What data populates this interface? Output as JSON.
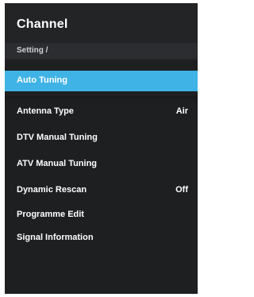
{
  "header": {
    "title": "Channel",
    "breadcrumb": "Setting /"
  },
  "menu": {
    "items": [
      {
        "label": "Auto Tuning",
        "value": "",
        "selected": true
      },
      {
        "label": "Antenna Type",
        "value": "Air",
        "selected": false
      },
      {
        "label": "DTV Manual Tuning",
        "value": "",
        "selected": false
      },
      {
        "label": "ATV Manual Tuning",
        "value": "",
        "selected": false
      },
      {
        "label": "Dynamic Rescan",
        "value": "Off",
        "selected": false
      },
      {
        "label": "Programme Edit",
        "value": "",
        "selected": false
      },
      {
        "label": "Signal Information",
        "value": "",
        "selected": false
      }
    ]
  },
  "colors": {
    "background": "#1e1f21",
    "highlight": "#3fb3e6",
    "text": "#ffffff"
  }
}
